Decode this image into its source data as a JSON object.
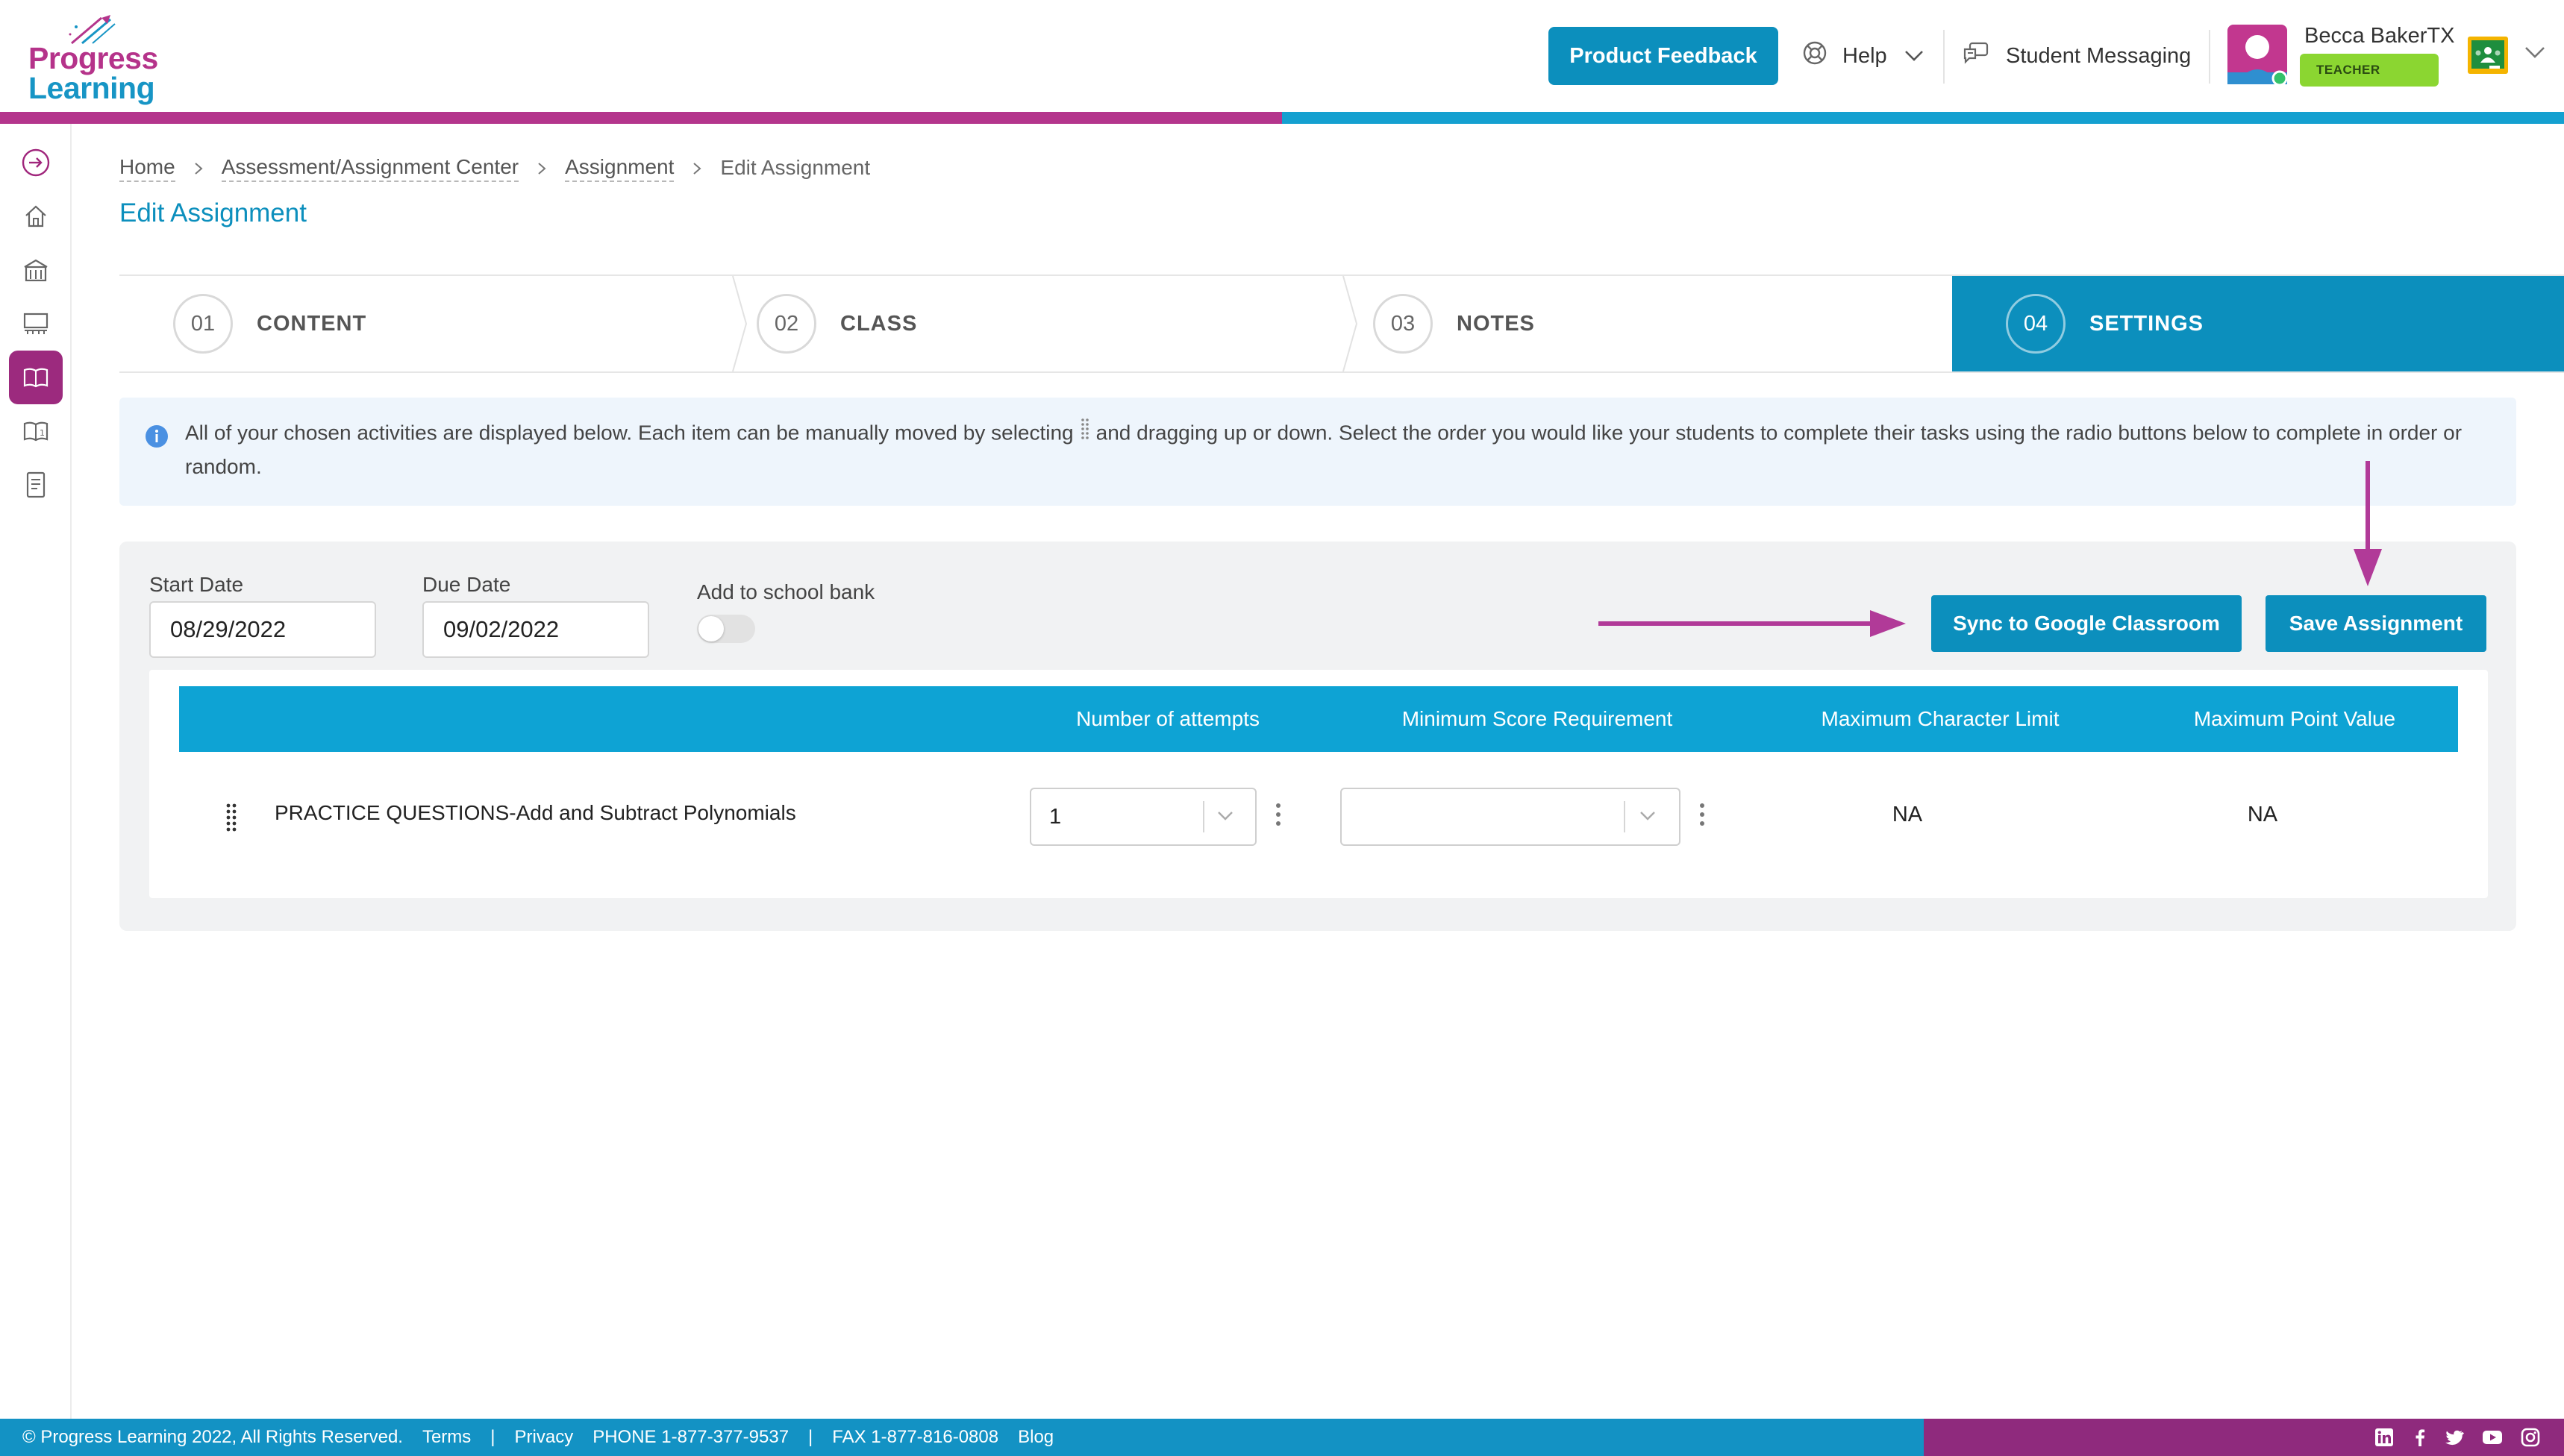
{
  "header": {
    "logo_line1": "Progress",
    "logo_line2": "Learning",
    "feedback_label": "Product Feedback",
    "help_label": "Help",
    "messaging_label": "Student Messaging",
    "user_name": "Becca BakerTX",
    "role_badge": "TEACHER",
    "colors": {
      "brand_purple": "#b4358c",
      "brand_blue": "#0c8fbd",
      "badge_green": "#8bd631"
    }
  },
  "sidebar": {
    "items": [
      {
        "icon": "expand-arrow-icon"
      },
      {
        "icon": "home-icon"
      },
      {
        "icon": "school-building-icon"
      },
      {
        "icon": "classroom-icon"
      },
      {
        "icon": "open-book-icon",
        "active": true
      },
      {
        "icon": "gradebook-icon"
      },
      {
        "icon": "report-icon"
      }
    ]
  },
  "breadcrumb": {
    "items": [
      "Home",
      "Assessment/Assignment Center",
      "Assignment",
      "Edit Assignment"
    ]
  },
  "page_title": "Edit Assignment",
  "steps": [
    {
      "num": "01",
      "label": "CONTENT",
      "active": false
    },
    {
      "num": "02",
      "label": "CLASS",
      "active": false
    },
    {
      "num": "03",
      "label": "NOTES",
      "active": false
    },
    {
      "num": "04",
      "label": "SETTINGS",
      "active": true
    }
  ],
  "info": {
    "text_before": "All of your chosen activities are displayed below. Each item can be manually moved by selecting",
    "text_after": "and dragging up or down. Select the order you would like your students to complete their tasks using the radio buttons below to complete in order or random."
  },
  "settings": {
    "start_date_label": "Start Date",
    "start_date_value": "08/29/2022",
    "due_date_label": "Due Date",
    "due_date_value": "09/02/2022",
    "school_bank_label": "Add to school bank",
    "school_bank_on": false,
    "sync_button": "Sync to Google Classroom",
    "save_button": "Save Assignment"
  },
  "table": {
    "columns": [
      "Number of attempts",
      "Minimum Score Requirement",
      "Maximum Character Limit",
      "Maximum Point Value"
    ],
    "rows": [
      {
        "title": "PRACTICE QUESTIONS-Add and Subtract Polynomials",
        "attempts": "1",
        "min_score": "",
        "max_char_limit": "NA",
        "max_point_value": "NA"
      }
    ]
  },
  "annotation_color": "#b13a98",
  "footer": {
    "copyright": "© Progress Learning 2022, All Rights Reserved.",
    "terms": "Terms",
    "divider": "|",
    "privacy": "Privacy",
    "phone": "PHONE 1-877-377-9537",
    "fax": "FAX 1-877-816-0808",
    "blog": "Blog",
    "social_icons": [
      "linkedin-icon",
      "facebook-icon",
      "twitter-icon",
      "youtube-icon",
      "instagram-icon"
    ]
  }
}
